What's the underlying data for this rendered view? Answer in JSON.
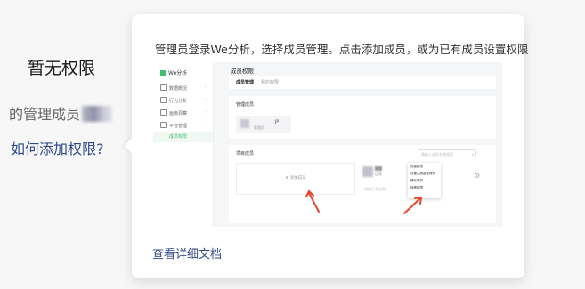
{
  "left": {
    "no_permission": "暂无权限",
    "admin_prefix": "的管理成员",
    "how_to_add": "如何添加权限?"
  },
  "card": {
    "description": "管理员登录We分析，选择成员管理。点击添加成员，或为已有成员设置权限",
    "doc_link": "查看详细文档"
  },
  "shot": {
    "logo": "We分析",
    "nav_items": [
      "数据概况",
      "行为分析",
      "画像洞察",
      "平台管理"
    ],
    "nav_active": "成员权限",
    "title": "成员权限",
    "tabs": [
      "成员管理",
      "我的权限"
    ],
    "admin_label": "管理成员",
    "admin_role": "管理员",
    "admin_tag": "JP",
    "project_label": "项目成员",
    "search_placeholder": "请输入成员名称搜索",
    "add_member": "添加成员",
    "member_line": "运营",
    "member_bottom": "添加已有权限",
    "menu_items": [
      "设置权限",
      "设置为超级管理员",
      "移除成员",
      "转移权限"
    ]
  },
  "colors": {
    "accent": "#3fbf6f",
    "link": "#2f4a8a",
    "arrow": "#e8462c"
  }
}
